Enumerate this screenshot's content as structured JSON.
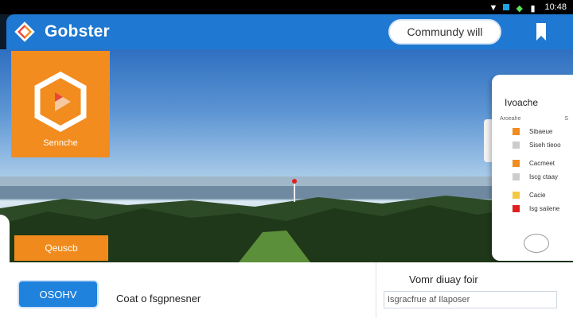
{
  "status_bar": {
    "time": "10:48",
    "icons": [
      "wifi-icon",
      "signal-icon",
      "battery-icon",
      "notification-icon"
    ]
  },
  "app_bar": {
    "title": "Gobster",
    "search_label": "Commundy will",
    "logo": "app-logo-icon",
    "menu": "bookmark-icon"
  },
  "promo": {
    "caption": "Sennche",
    "button_label": "Qeuscb",
    "icon": "hexagon-play-icon"
  },
  "phone_panel": {
    "title": "Ivoache",
    "header_left": "Aroeahe",
    "header_right": "S",
    "items": [
      {
        "label": "Sibaeue",
        "color": "#f28c1f"
      },
      {
        "label": "Siseh tieoo",
        "color": "#cccccc"
      },
      {
        "label": "Cacmeet",
        "color": "#f28c1f"
      },
      {
        "label": "Iscg ctaay",
        "color": "#cccccc"
      },
      {
        "label": "Cacie",
        "color": "#f5c842"
      },
      {
        "label": "Isg saiiene",
        "color": "#e02020"
      }
    ]
  },
  "bottom": {
    "primary_button": "OSOHV",
    "caption": "Coat o fsgpnesner",
    "field_label": "Vomr diuay foir",
    "field_value": "Isgracfrue af Ilaposer"
  },
  "colors": {
    "brand_blue": "#1f78d1",
    "accent_orange": "#f28c1f"
  }
}
